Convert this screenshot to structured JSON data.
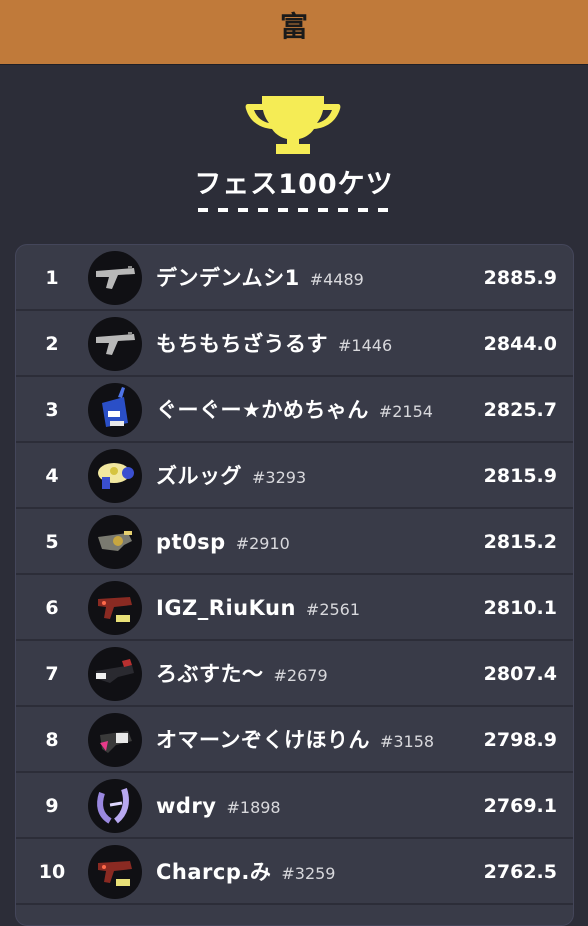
{
  "header": {
    "title": "富"
  },
  "leaderboard": {
    "title": "フェス100ケツ",
    "accent_color": "#f5ec55",
    "rows": [
      {
        "rank": "1",
        "name": "デンデンムシ1",
        "tag": "#4489",
        "score": "2885.9",
        "weapon_icon": "gray-rifle-icon"
      },
      {
        "rank": "2",
        "name": "もちもちざうるす",
        "tag": "#1446",
        "score": "2844.0",
        "weapon_icon": "gray-rifle-icon"
      },
      {
        "rank": "3",
        "name": "ぐーぐー★かめちゃん",
        "tag": "#2154",
        "score": "2825.7",
        "weapon_icon": "blue-bucket-icon"
      },
      {
        "rank": "4",
        "name": "ズルッグ",
        "tag": "#3293",
        "score": "2815.9",
        "weapon_icon": "yellow-blaster-icon"
      },
      {
        "rank": "5",
        "name": "pt0sp",
        "tag": "#2910",
        "score": "2815.2",
        "weapon_icon": "brass-blaster-icon"
      },
      {
        "rank": "6",
        "name": "IGZ_RiuKun",
        "tag": "#2561",
        "score": "2810.1",
        "weapon_icon": "red-shooter-icon"
      },
      {
        "rank": "7",
        "name": "ろぶすた〜",
        "tag": "#2679",
        "score": "2807.4",
        "weapon_icon": "dark-shooter-icon"
      },
      {
        "rank": "8",
        "name": "オマーンぞくけほりん",
        "tag": "#3158",
        "score": "2798.9",
        "weapon_icon": "pink-shooter-icon"
      },
      {
        "rank": "9",
        "name": "wdry",
        "tag": "#1898",
        "score": "2769.1",
        "weapon_icon": "purple-stringer-icon"
      },
      {
        "rank": "10",
        "name": "Charcp.み",
        "tag": "#3259",
        "score": "2762.5",
        "weapon_icon": "red-shooter-icon"
      }
    ]
  }
}
